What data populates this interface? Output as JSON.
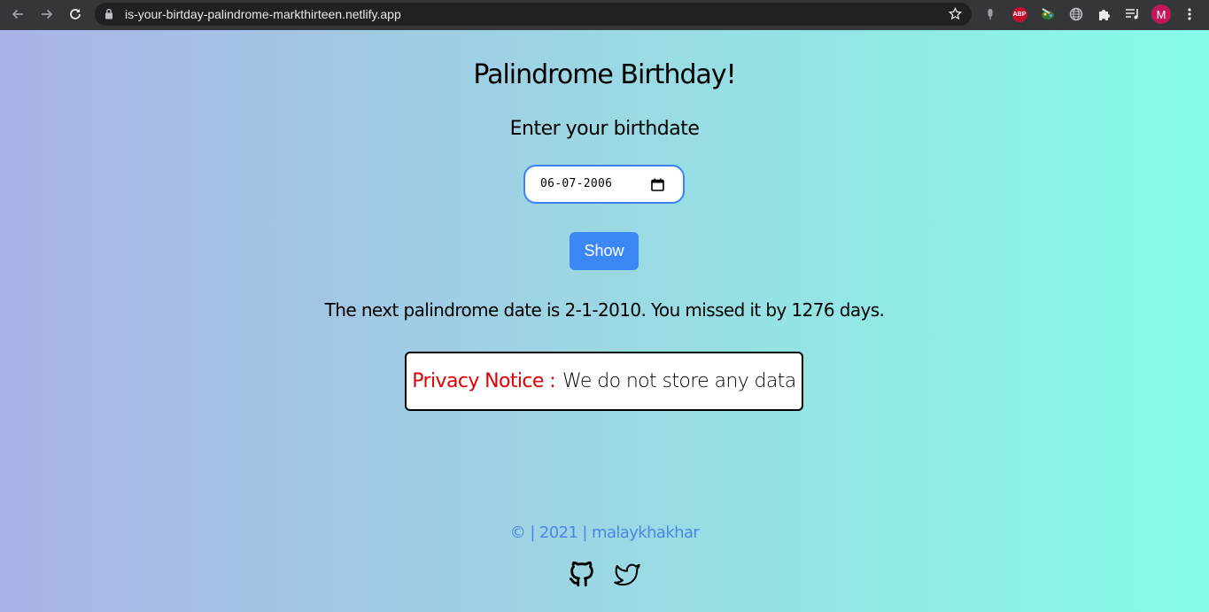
{
  "browser": {
    "url": "is-your-birtday-palindrome-markthirteen.netlify.app",
    "avatar_letter": "M",
    "extension_abp": "ABP"
  },
  "icons": {
    "back": "back-arrow-icon",
    "forward": "forward-arrow-icon",
    "reload": "reload-icon",
    "lock": "lock-icon",
    "star": "star-icon",
    "github": "github-icon",
    "twitter": "twitter-icon"
  },
  "page": {
    "title": "Palindrome Birthday!",
    "subtitle": "Enter your birthdate",
    "date_value": "06-07-2006",
    "show_label": "Show",
    "result": "The next palindrome date is 2-1-2010. You missed it by 1276 days.",
    "privacy_label": "Privacy Notice :",
    "privacy_text": "We do not store any data",
    "footer": "© | 2021 | malaykhakhar"
  },
  "colors": {
    "accent": "#3b88f5",
    "privacy_label": "#e10000",
    "footer": "#4a86e8",
    "gradient_left": "#aab3e6",
    "gradient_right": "#86fce7"
  }
}
